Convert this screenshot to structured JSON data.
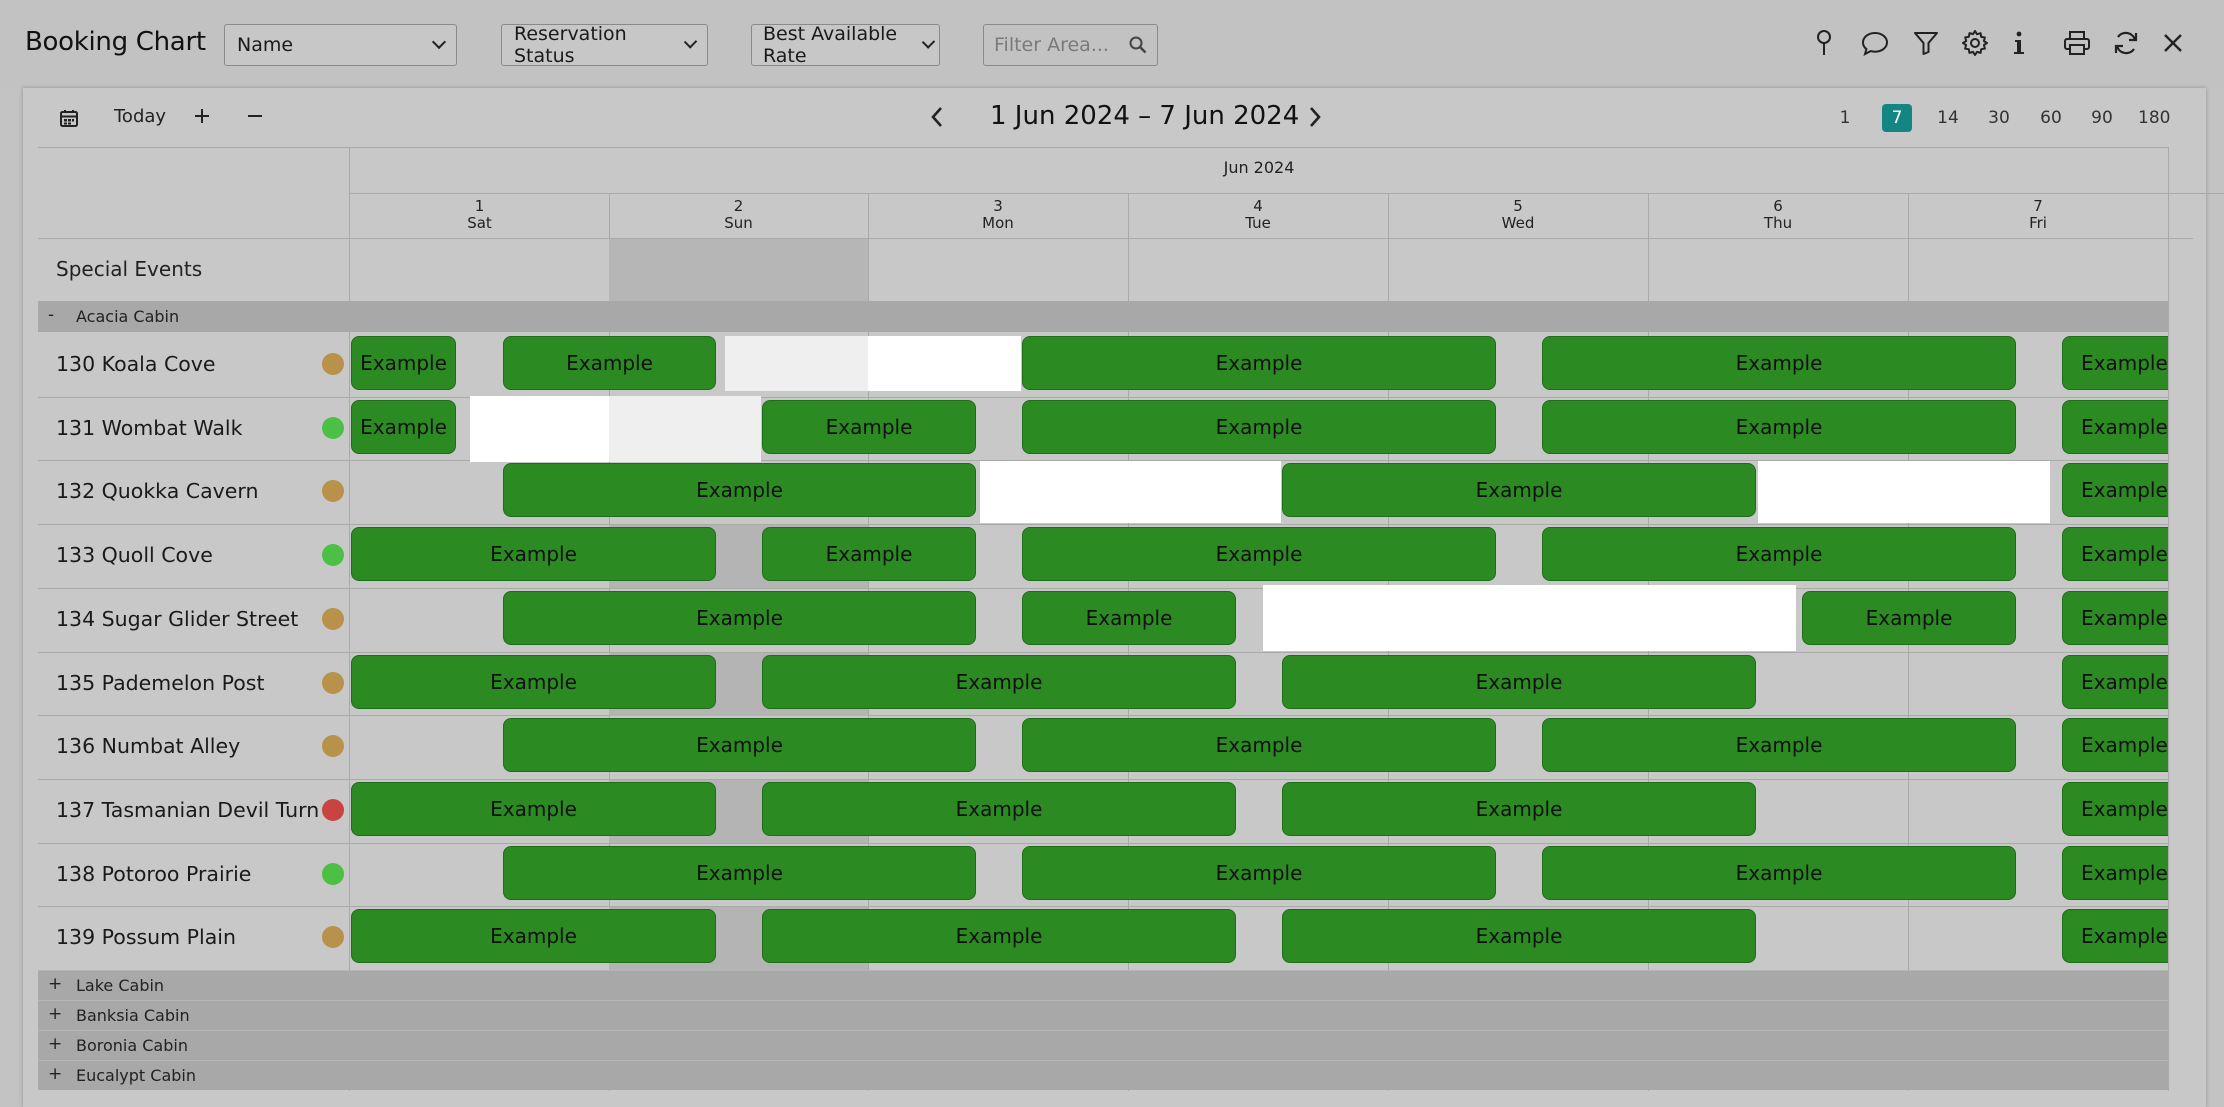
{
  "app_title": "Booking Chart",
  "toolbar": {
    "sort_select": "Name",
    "status_select": "Reservation Status",
    "rate_select": "Best Available Rate",
    "filter_placeholder": "Filter Area...",
    "icons": [
      "pin-icon",
      "comment-icon",
      "filter-icon",
      "gear-icon",
      "info-icon",
      "print-icon",
      "refresh-icon",
      "close-icon"
    ]
  },
  "nav": {
    "today_label": "Today",
    "date_range": "1 Jun 2024 – 7 Jun 2024",
    "zoom_options": [
      "1",
      "7",
      "14",
      "30",
      "60",
      "90",
      "180"
    ],
    "zoom_selected": "7"
  },
  "header": {
    "month": "Jun 2024",
    "days": [
      {
        "num": "1",
        "dow": "Sat"
      },
      {
        "num": "2",
        "dow": "Sun"
      },
      {
        "num": "3",
        "dow": "Mon"
      },
      {
        "num": "4",
        "dow": "Tue"
      },
      {
        "num": "5",
        "dow": "Wed"
      },
      {
        "num": "6",
        "dow": "Thu"
      },
      {
        "num": "7",
        "dow": "Fri"
      }
    ]
  },
  "special_events_label": "Special Events",
  "groups": {
    "expanded": {
      "toggle": "-",
      "name": "Acacia Cabin"
    },
    "collapsed": [
      {
        "toggle": "+",
        "name": "Lake Cabin"
      },
      {
        "toggle": "+",
        "name": "Banksia Cabin"
      },
      {
        "toggle": "+",
        "name": "Boronia Cabin"
      },
      {
        "toggle": "+",
        "name": "Eucalypt Cabin"
      }
    ]
  },
  "booking_label": "Example",
  "colors": {
    "booking": "#2b8a22",
    "status_gold": "#b8924a",
    "status_green": "#4cbf45",
    "status_red": "#c94440",
    "zoom_active": "#138582"
  },
  "rooms": [
    {
      "name": "130 Koala Cove",
      "status": "status_gold"
    },
    {
      "name": "131 Wombat Walk",
      "status": "status_green"
    },
    {
      "name": "132 Quokka Cavern",
      "status": "status_gold"
    },
    {
      "name": "133 Quoll Cove",
      "status": "status_green"
    },
    {
      "name": "134 Sugar Glider Street",
      "status": "status_gold"
    },
    {
      "name": "135 Pademelon Post",
      "status": "status_gold"
    },
    {
      "name": "136 Numbat Alley",
      "status": "status_gold"
    },
    {
      "name": "137 Tasmanian Devil Turn",
      "status": "status_red"
    },
    {
      "name": "138 Potoroo Prairie",
      "status": "status_green"
    },
    {
      "name": "139 Possum Plain",
      "status": "status_gold"
    }
  ]
}
